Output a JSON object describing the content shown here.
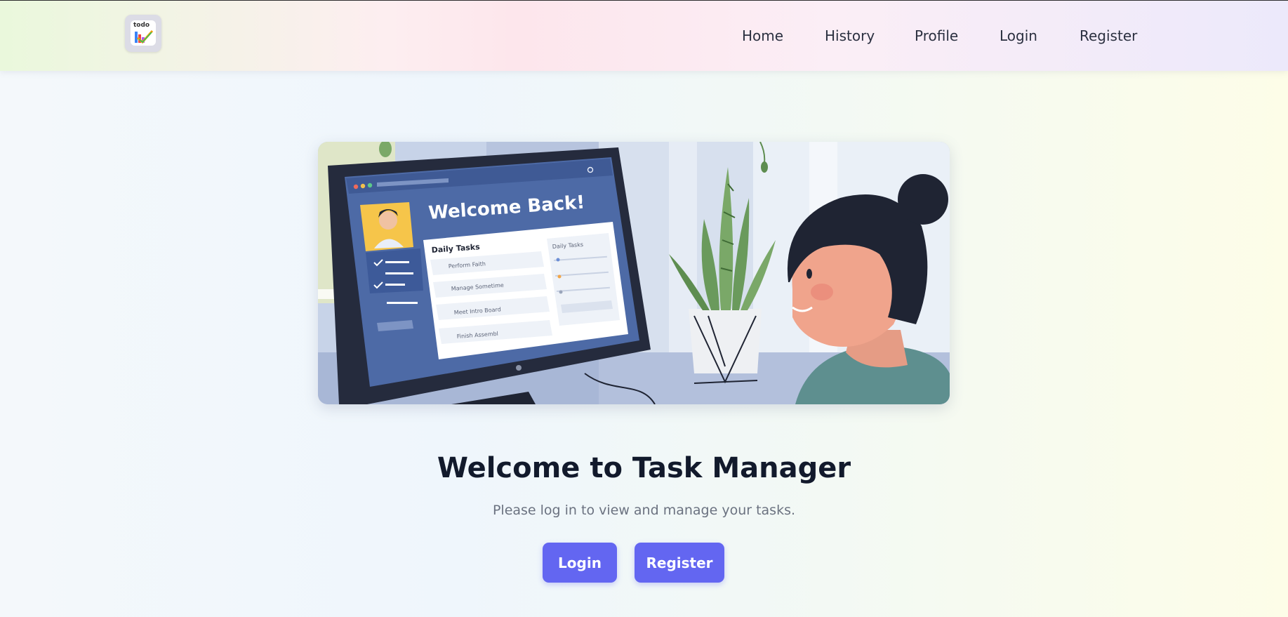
{
  "brand": {
    "logo_text": "todo",
    "icon": "todo-logo-icon"
  },
  "nav": {
    "items": [
      {
        "label": "Home"
      },
      {
        "label": "History"
      },
      {
        "label": "Profile"
      },
      {
        "label": "Login"
      },
      {
        "label": "Register"
      }
    ]
  },
  "hero": {
    "screen_heading": "Welcome Back!",
    "card_title": "Daily Tasks",
    "side_title": "Daily Tasks",
    "tasks": [
      "Perform Faith",
      "Manage Sometime",
      "Meet Intro Board",
      "Finish Assembl"
    ]
  },
  "main": {
    "title": "Welcome to Task Manager",
    "subtitle": "Please log in to view and manage your tasks.",
    "login_label": "Login",
    "register_label": "Register"
  },
  "colors": {
    "accent": "#6366f1",
    "title": "#121a2c",
    "subtitle": "#6b7280",
    "nav_text": "#2b3040"
  }
}
